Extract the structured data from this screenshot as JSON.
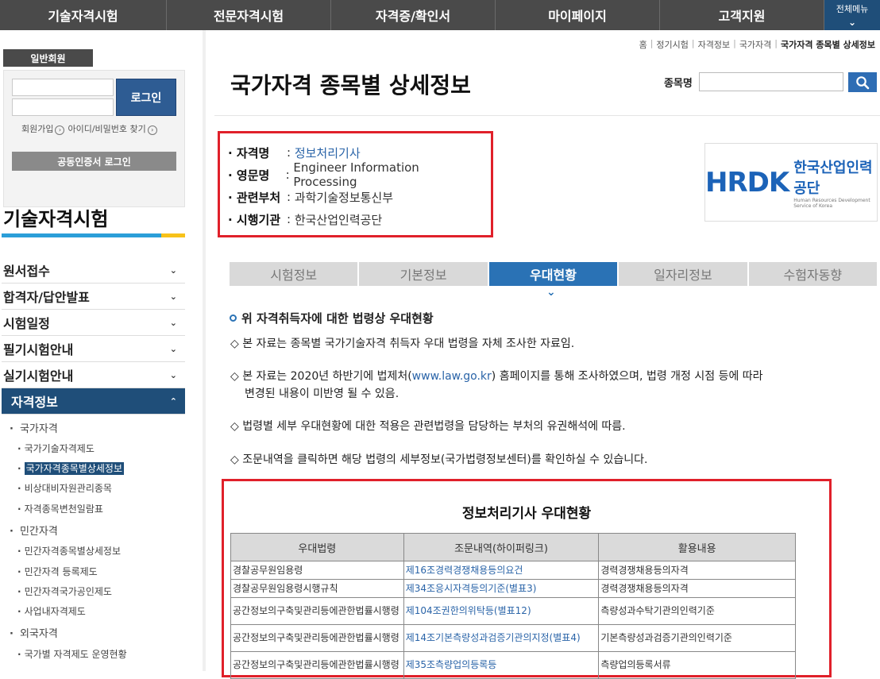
{
  "topnav": {
    "items": [
      "기술자격시험",
      "전문자격시험",
      "자격증/확인서",
      "마이페이지",
      "고객지원"
    ],
    "all_menu": "전체메뉴"
  },
  "sidebar": {
    "member_tag": "일반회원",
    "login_button": "로그인",
    "signup_link": "회원가입",
    "find_link": "아이디/비밀번호 찾기",
    "cert_login": "공동인증서 로그인",
    "section_title": "기술자격시험",
    "menu": [
      "원서접수",
      "합격자/답안발표",
      "시험일정",
      "필기시험안내",
      "실기시험안내"
    ],
    "active_menu": "자격정보",
    "groups": {
      "national": "국가자격",
      "national_items": [
        "국가기술자격제도",
        "국가자격종목별상세정보",
        "비상대비자원관리종목",
        "자격종목변천일람표"
      ],
      "private": "민간자격",
      "private_items": [
        "민간자격종목별상세정보",
        "민간자격 등록제도",
        "민간자격국가공인제도",
        "사업내자격제도"
      ],
      "foreign": "외국자격",
      "foreign_items": [
        "국가별 자격제도 운영현황"
      ]
    }
  },
  "breadcrumb": [
    "홈",
    "정기시험",
    "자격정보",
    "국가자격",
    "국가자격 종목별 상세정보"
  ],
  "page_title": "국가자격 종목별 상세정보",
  "search": {
    "label": "종목명",
    "value": ""
  },
  "info": {
    "rows": [
      {
        "key": "자격명",
        "value": "정보처리기사"
      },
      {
        "key": "영문명",
        "value": "Engineer Information Processing"
      },
      {
        "key": "관련부처",
        "value": "과학기술정보통신부"
      },
      {
        "key": "시행기관",
        "value": "한국산업인력공단"
      }
    ]
  },
  "logo": {
    "mark": "HRDK",
    "ko": "한국산업인력공단",
    "en": "Human Resources Development Service of Korea"
  },
  "tabs": [
    "시험정보",
    "기본정보",
    "우대현황",
    "일자리정보",
    "수험자동향"
  ],
  "active_tab": "우대현황",
  "section_heading": "위 자격취득자에 대한 법령상 우대현황",
  "notes": {
    "n1": "◇ 본 자료는 종목별 국가기술자격 취득자 우대 법령을 자체 조사한 자료임.",
    "n2_pre": "◇ 본 자료는 2020년 하반기에 법제처(",
    "n2_link": "www.law.go.kr",
    "n2_post": ") 홈페이지를 통해 조사하였으며, 법령 개정 시점 등에 따라",
    "n2_line2": "변경된 내용이 미반영 될 수 있음.",
    "n3": "◇ 법령별 세부 우대현황에 대한 적용은 관련법령을 담당하는 부처의 유권해석에 따름.",
    "n4": "◇ 조문내역을 클릭하면 해당 법령의 세부정보(국가법령정보센터)를 확인하실 수 있습니다."
  },
  "table": {
    "title": "정보처리기사 우대현황",
    "headers": [
      "우대법령",
      "조문내역(하이퍼링크)",
      "활용내용"
    ],
    "rows": [
      [
        "경찰공무원임용령",
        "제16조경력경쟁채용등의요건",
        "경력경쟁채용등의자격"
      ],
      [
        "경찰공무원임용령시행규칙",
        "제34조응시자격등의기준(별표3)",
        "경력경쟁채용등의자격"
      ],
      [
        "공간정보의구축및관리등에관한법률시행령",
        "제104조권한의위탁등(별표12)",
        "측량성과수탁기관의인력기준"
      ],
      [
        "공간정보의구축및관리등에관한법률시행령",
        "제14조기본측량성과검증기관의지정(별표4)",
        "기본측량성과검증기관의인력기준"
      ],
      [
        "공간정보의구축및관리등에관한법률시행령",
        "제35조측량업의등록등",
        "측량업의등록서류"
      ]
    ]
  },
  "colors": {
    "nav_bg": "#4a4a4a",
    "active_blue": "#1f4e79",
    "tab_blue": "#2a72b5",
    "highlight_red": "#e0202a"
  }
}
